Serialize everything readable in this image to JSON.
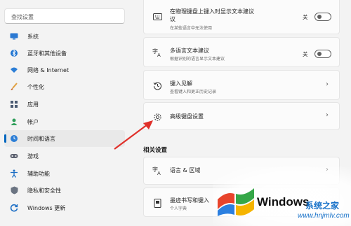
{
  "sidebar": {
    "search_placeholder": "查找设置",
    "items": [
      {
        "label": "系统",
        "icon": "monitor-icon"
      },
      {
        "label": "蓝牙和其他设备",
        "icon": "bluetooth-icon"
      },
      {
        "label": "网络 & Internet",
        "icon": "wifi-icon"
      },
      {
        "label": "个性化",
        "icon": "brush-icon"
      },
      {
        "label": "应用",
        "icon": "apps-icon"
      },
      {
        "label": "帐户",
        "icon": "person-icon"
      },
      {
        "label": "时间和语言",
        "icon": "globe-clock-icon",
        "active": true
      },
      {
        "label": "游戏",
        "icon": "game-icon"
      },
      {
        "label": "辅助功能",
        "icon": "accessibility-icon"
      },
      {
        "label": "隐私和安全性",
        "icon": "shield-icon"
      },
      {
        "label": "Windows 更新",
        "icon": "update-icon"
      }
    ]
  },
  "content": {
    "cards": [
      {
        "title": "在物理键盘上键入时显示文本建议",
        "title2": "议",
        "desc": "在某些语言中无法使用",
        "state": "关",
        "icon": "keyboard-icon"
      },
      {
        "title": "多语言文本建议",
        "desc": "根据识别的语言显示文本建议",
        "state": "关",
        "icon": "language-icon"
      },
      {
        "title": "键入见解",
        "desc": "查看键入和更正历史记录",
        "icon": "history-icon"
      },
      {
        "title": "高级键盘设置",
        "icon": "gear-icon"
      }
    ],
    "related_heading": "相关设置",
    "related": [
      {
        "title": "语言 & 区域",
        "icon": "language-region-icon"
      },
      {
        "title": "墨迹书写和键入",
        "desc": "个人字典",
        "icon": "pen-icon"
      }
    ]
  },
  "watermark": {
    "title": "Windows",
    "cn": "系统之家",
    "url": "www.hnjmlv.com"
  },
  "colors": {
    "accent": "#0067c0",
    "arrow": "#e0302a"
  }
}
